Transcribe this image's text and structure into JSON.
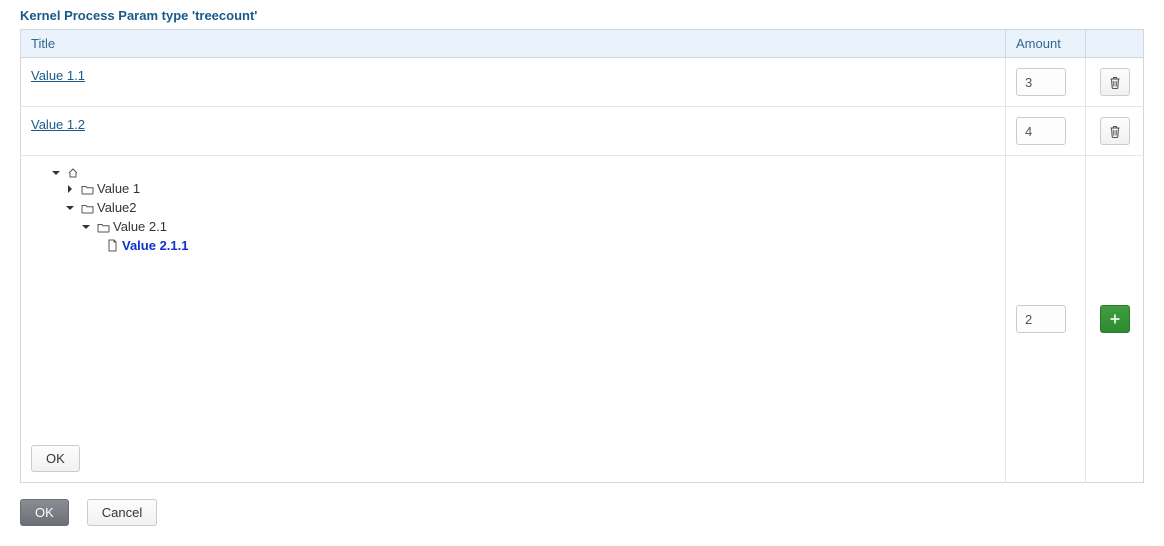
{
  "panel": {
    "title": "Kernel Process Param type 'treecount'"
  },
  "table": {
    "headers": {
      "title": "Title",
      "amount": "Amount"
    }
  },
  "rows": [
    {
      "title": "Value 1.1",
      "amount": "3"
    },
    {
      "title": "Value 1.2",
      "amount": "4"
    }
  ],
  "editor": {
    "tree": {
      "root": "",
      "nodes": {
        "n0": "Value 1",
        "n1": "Value2",
        "n2": "Value 2.1",
        "n3": "Value 2.1.1"
      }
    },
    "inner_ok": "OK",
    "amount": "2"
  },
  "footer": {
    "ok": "OK",
    "cancel": "Cancel"
  }
}
